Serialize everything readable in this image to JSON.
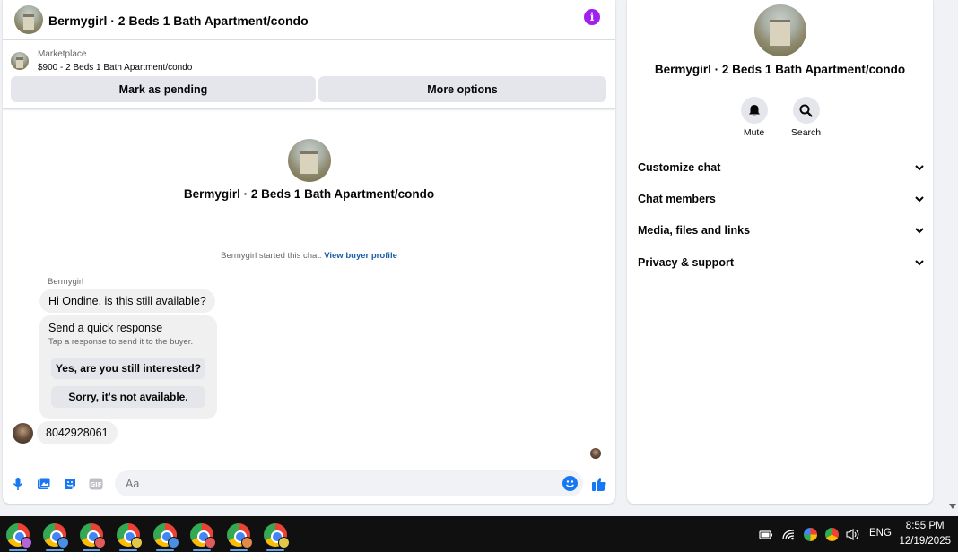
{
  "chat": {
    "title": "Bermygirl · 2 Beds 1 Bath Apartment/condo",
    "info_icon": "info-icon"
  },
  "listing": {
    "source": "Marketplace",
    "detail": "$900 - 2 Beds 1 Bath Apartment/condo",
    "mark_pending_label": "Mark as pending",
    "more_options_label": "More options"
  },
  "thread": {
    "profile_name": "Bermygirl · 2 Beds 1 Bath Apartment/condo",
    "started_text": "Bermygirl started this chat.",
    "view_profile_link": "View buyer profile",
    "sender_name": "Bermygirl",
    "messages": [
      {
        "text": "Hi Ondine, is this still available?"
      },
      {
        "text": "8042928061"
      }
    ],
    "quick_response": {
      "title": "Send a quick response",
      "subtitle": "Tap a response to send it to the buyer.",
      "options": [
        "Yes, are you still interested?",
        "Sorry, it's not available."
      ]
    }
  },
  "composer": {
    "placeholder": "Aa"
  },
  "info_panel": {
    "name": "Bermygirl · 2 Beds 1 Bath Apartment/condo",
    "actions": [
      {
        "label": "Mute",
        "icon": "bell-icon"
      },
      {
        "label": "Search",
        "icon": "search-icon"
      }
    ],
    "sections": [
      {
        "label": "Customize chat"
      },
      {
        "label": "Chat members"
      },
      {
        "label": "Media, files and links"
      },
      {
        "label": "Privacy & support"
      }
    ]
  },
  "taskbar": {
    "language": "ENG",
    "time": "8:55 PM",
    "date": "12/19/2025"
  },
  "colors": {
    "accent": "#1877f2",
    "info": "#a020f0",
    "link": "#1b5fa8",
    "button_bg": "#e4e6eb",
    "bubble_bg": "#f0f0f0",
    "taskbar_bg": "#101010"
  }
}
